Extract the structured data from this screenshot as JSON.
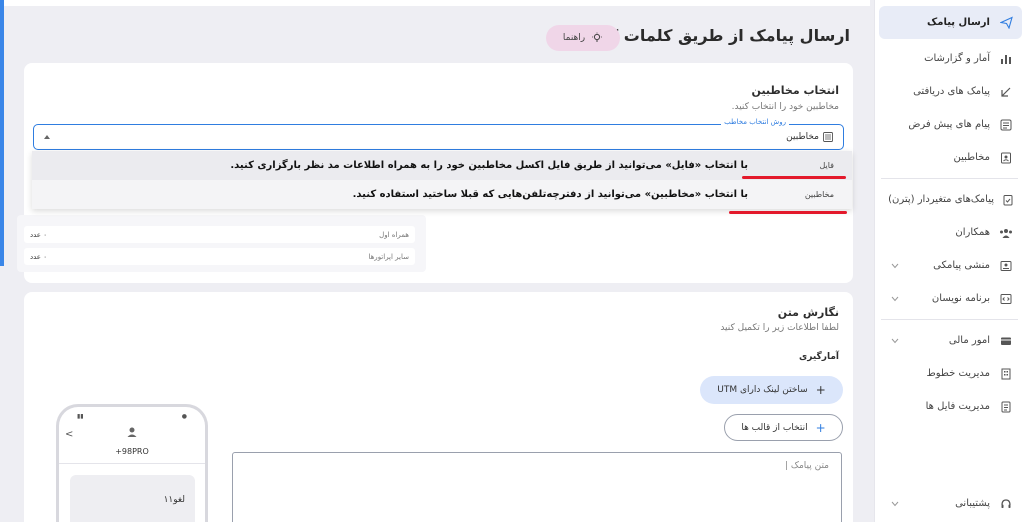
{
  "page": {
    "title": "ارسال پیامک از طریق کلمات کلیدی",
    "guide_label": "راهنما"
  },
  "sidebar": {
    "items": [
      {
        "label": "ارسال پیامک",
        "icon": "send-icon",
        "active": true
      },
      {
        "label": "آمار و گزارشات",
        "icon": "bar-chart-icon"
      },
      {
        "label": "پیامک های دریافتی",
        "icon": "arrow-down-left-icon"
      },
      {
        "label": "پیام های پیش فرض",
        "icon": "message-list-icon"
      },
      {
        "label": "مخاطبین",
        "icon": "contact-icon"
      },
      {
        "label": "پیامک‌های متغیردار (پترن)",
        "icon": "clipboard-check-icon"
      },
      {
        "label": "همکاران",
        "icon": "users-icon"
      },
      {
        "label": "منشی پیامکی",
        "icon": "id-card-icon",
        "expandable": true
      },
      {
        "label": "برنامه نویسان",
        "icon": "code-icon",
        "expandable": true
      },
      {
        "label": "امور مالی",
        "icon": "wallet-icon",
        "expandable": true
      },
      {
        "label": "مدیریت خطوط",
        "icon": "building-icon"
      },
      {
        "label": "مدیریت فایل ها",
        "icon": "file-list-icon"
      },
      {
        "label": "پشتیبانی",
        "icon": "headset-icon",
        "expandable": true
      }
    ]
  },
  "contacts": {
    "title": "انتخاب مخاطبین",
    "subtitle": "مخاطبین خود را انتخاب کنید.",
    "select_legend": "روش انتخاب مخاطب",
    "select_value": "مخاطبین",
    "options": [
      {
        "label": "فایل",
        "note": "با انتخاب «فایل» می‌توانید از طریق فایل اکسل مخاطبین خود را به همراه اطلاعات مد نظر بارگزاری کنید."
      },
      {
        "label": "مخاطبین",
        "note": "با انتخاب «مخاطبین» می‌توانید از دفترچه‌تلفن‌هایی که قبلا ساختید استفاده کنید."
      }
    ],
    "stats": [
      {
        "label": "همراه اول",
        "value": "۰ عدد"
      },
      {
        "label": "سایر اپراتورها",
        "value": "۰ عدد"
      }
    ]
  },
  "compose": {
    "title": "نگارش متن",
    "subtitle": "لطفا اطلاعات زیر را تکمیل کنید",
    "stats_label": "آمارگیری",
    "utm_button": "ساختن لینک دارای UTM",
    "template_button": "انتخاب از قالب ها",
    "textarea_placeholder": "متن پیامک |"
  },
  "phone": {
    "sender": "+98PRO",
    "bubble_text": "لغو۱۱"
  },
  "colors": {
    "accent": "#2f7de0",
    "highlight_line": "#e3192b",
    "guide_bg": "#f0d6e8",
    "utm_bg": "#dbe6fb"
  }
}
